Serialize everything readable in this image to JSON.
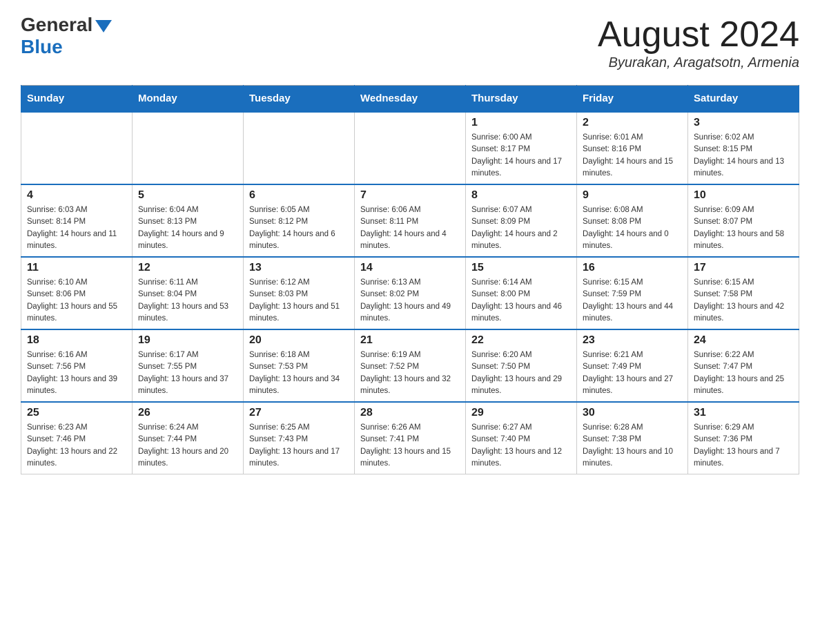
{
  "header": {
    "logo_general": "General",
    "logo_blue": "Blue",
    "month_title": "August 2024",
    "location": "Byurakan, Aragatsotn, Armenia"
  },
  "weekdays": [
    "Sunday",
    "Monday",
    "Tuesday",
    "Wednesday",
    "Thursday",
    "Friday",
    "Saturday"
  ],
  "weeks": [
    [
      {
        "day": "",
        "info": ""
      },
      {
        "day": "",
        "info": ""
      },
      {
        "day": "",
        "info": ""
      },
      {
        "day": "",
        "info": ""
      },
      {
        "day": "1",
        "info": "Sunrise: 6:00 AM\nSunset: 8:17 PM\nDaylight: 14 hours and 17 minutes."
      },
      {
        "day": "2",
        "info": "Sunrise: 6:01 AM\nSunset: 8:16 PM\nDaylight: 14 hours and 15 minutes."
      },
      {
        "day": "3",
        "info": "Sunrise: 6:02 AM\nSunset: 8:15 PM\nDaylight: 14 hours and 13 minutes."
      }
    ],
    [
      {
        "day": "4",
        "info": "Sunrise: 6:03 AM\nSunset: 8:14 PM\nDaylight: 14 hours and 11 minutes."
      },
      {
        "day": "5",
        "info": "Sunrise: 6:04 AM\nSunset: 8:13 PM\nDaylight: 14 hours and 9 minutes."
      },
      {
        "day": "6",
        "info": "Sunrise: 6:05 AM\nSunset: 8:12 PM\nDaylight: 14 hours and 6 minutes."
      },
      {
        "day": "7",
        "info": "Sunrise: 6:06 AM\nSunset: 8:11 PM\nDaylight: 14 hours and 4 minutes."
      },
      {
        "day": "8",
        "info": "Sunrise: 6:07 AM\nSunset: 8:09 PM\nDaylight: 14 hours and 2 minutes."
      },
      {
        "day": "9",
        "info": "Sunrise: 6:08 AM\nSunset: 8:08 PM\nDaylight: 14 hours and 0 minutes."
      },
      {
        "day": "10",
        "info": "Sunrise: 6:09 AM\nSunset: 8:07 PM\nDaylight: 13 hours and 58 minutes."
      }
    ],
    [
      {
        "day": "11",
        "info": "Sunrise: 6:10 AM\nSunset: 8:06 PM\nDaylight: 13 hours and 55 minutes."
      },
      {
        "day": "12",
        "info": "Sunrise: 6:11 AM\nSunset: 8:04 PM\nDaylight: 13 hours and 53 minutes."
      },
      {
        "day": "13",
        "info": "Sunrise: 6:12 AM\nSunset: 8:03 PM\nDaylight: 13 hours and 51 minutes."
      },
      {
        "day": "14",
        "info": "Sunrise: 6:13 AM\nSunset: 8:02 PM\nDaylight: 13 hours and 49 minutes."
      },
      {
        "day": "15",
        "info": "Sunrise: 6:14 AM\nSunset: 8:00 PM\nDaylight: 13 hours and 46 minutes."
      },
      {
        "day": "16",
        "info": "Sunrise: 6:15 AM\nSunset: 7:59 PM\nDaylight: 13 hours and 44 minutes."
      },
      {
        "day": "17",
        "info": "Sunrise: 6:15 AM\nSunset: 7:58 PM\nDaylight: 13 hours and 42 minutes."
      }
    ],
    [
      {
        "day": "18",
        "info": "Sunrise: 6:16 AM\nSunset: 7:56 PM\nDaylight: 13 hours and 39 minutes."
      },
      {
        "day": "19",
        "info": "Sunrise: 6:17 AM\nSunset: 7:55 PM\nDaylight: 13 hours and 37 minutes."
      },
      {
        "day": "20",
        "info": "Sunrise: 6:18 AM\nSunset: 7:53 PM\nDaylight: 13 hours and 34 minutes."
      },
      {
        "day": "21",
        "info": "Sunrise: 6:19 AM\nSunset: 7:52 PM\nDaylight: 13 hours and 32 minutes."
      },
      {
        "day": "22",
        "info": "Sunrise: 6:20 AM\nSunset: 7:50 PM\nDaylight: 13 hours and 29 minutes."
      },
      {
        "day": "23",
        "info": "Sunrise: 6:21 AM\nSunset: 7:49 PM\nDaylight: 13 hours and 27 minutes."
      },
      {
        "day": "24",
        "info": "Sunrise: 6:22 AM\nSunset: 7:47 PM\nDaylight: 13 hours and 25 minutes."
      }
    ],
    [
      {
        "day": "25",
        "info": "Sunrise: 6:23 AM\nSunset: 7:46 PM\nDaylight: 13 hours and 22 minutes."
      },
      {
        "day": "26",
        "info": "Sunrise: 6:24 AM\nSunset: 7:44 PM\nDaylight: 13 hours and 20 minutes."
      },
      {
        "day": "27",
        "info": "Sunrise: 6:25 AM\nSunset: 7:43 PM\nDaylight: 13 hours and 17 minutes."
      },
      {
        "day": "28",
        "info": "Sunrise: 6:26 AM\nSunset: 7:41 PM\nDaylight: 13 hours and 15 minutes."
      },
      {
        "day": "29",
        "info": "Sunrise: 6:27 AM\nSunset: 7:40 PM\nDaylight: 13 hours and 12 minutes."
      },
      {
        "day": "30",
        "info": "Sunrise: 6:28 AM\nSunset: 7:38 PM\nDaylight: 13 hours and 10 minutes."
      },
      {
        "day": "31",
        "info": "Sunrise: 6:29 AM\nSunset: 7:36 PM\nDaylight: 13 hours and 7 minutes."
      }
    ]
  ]
}
